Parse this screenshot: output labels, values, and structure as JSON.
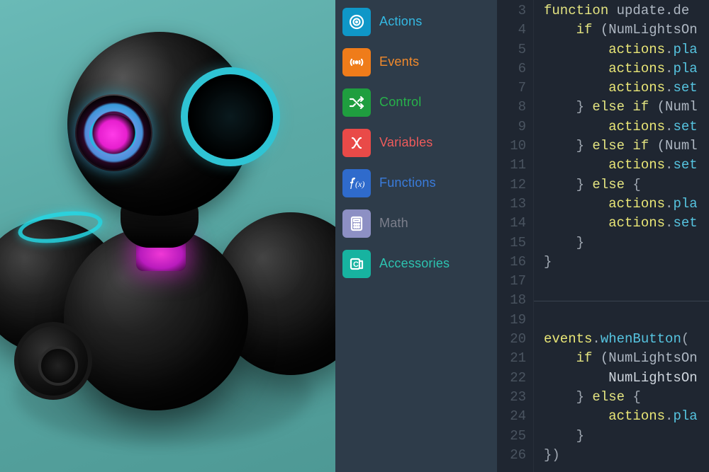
{
  "sidebar": {
    "items": [
      {
        "label": "Actions",
        "labelColor": "#34b9e3",
        "iconBg": "#0f97c8",
        "iconName": "target-icon"
      },
      {
        "label": "Events",
        "labelColor": "#f28a2b",
        "iconBg": "#ef7c1a",
        "iconName": "broadcast-icon"
      },
      {
        "label": "Control",
        "labelColor": "#27b24a",
        "iconBg": "#1f9e3f",
        "iconName": "shuffle-icon"
      },
      {
        "label": "Variables",
        "labelColor": "#ef5b5b",
        "iconBg": "#e94a48",
        "iconName": "x-variable-icon"
      },
      {
        "label": "Functions",
        "labelColor": "#3a7cdc",
        "iconBg": "#2f6bcc",
        "iconName": "fx-icon"
      },
      {
        "label": "Math",
        "labelColor": "#7c7f8c",
        "iconBg": "#8d90c4",
        "iconName": "calculator-icon"
      },
      {
        "label": "Accessories",
        "labelColor": "#2dc3b0",
        "iconBg": "#17b3a0",
        "iconName": "accessories-icon"
      }
    ]
  },
  "editor": {
    "lineStart": 3,
    "lines": [
      {
        "indent": 0,
        "tokens": [
          [
            "kw",
            "function"
          ],
          [
            "pl",
            " update.de"
          ]
        ]
      },
      {
        "indent": 1,
        "tokens": [
          [
            "kw",
            "if"
          ],
          [
            "pl",
            " (NumLightsOn"
          ]
        ]
      },
      {
        "indent": 2,
        "tokens": [
          [
            "obj",
            "actions"
          ],
          [
            "punc",
            "."
          ],
          [
            "fn",
            "pla"
          ]
        ]
      },
      {
        "indent": 2,
        "tokens": [
          [
            "obj",
            "actions"
          ],
          [
            "punc",
            "."
          ],
          [
            "fn",
            "pla"
          ]
        ]
      },
      {
        "indent": 2,
        "tokens": [
          [
            "obj",
            "actions"
          ],
          [
            "punc",
            "."
          ],
          [
            "fn",
            "set"
          ]
        ]
      },
      {
        "indent": 1,
        "tokens": [
          [
            "punc",
            "} "
          ],
          [
            "kw",
            "else if"
          ],
          [
            "pl",
            " (Numl"
          ]
        ]
      },
      {
        "indent": 2,
        "tokens": [
          [
            "obj",
            "actions"
          ],
          [
            "punc",
            "."
          ],
          [
            "fn",
            "set"
          ]
        ]
      },
      {
        "indent": 1,
        "tokens": [
          [
            "punc",
            "} "
          ],
          [
            "kw",
            "else if"
          ],
          [
            "pl",
            " (Numl"
          ]
        ]
      },
      {
        "indent": 2,
        "tokens": [
          [
            "obj",
            "actions"
          ],
          [
            "punc",
            "."
          ],
          [
            "fn",
            "set"
          ]
        ]
      },
      {
        "indent": 1,
        "tokens": [
          [
            "punc",
            "} "
          ],
          [
            "kw",
            "else"
          ],
          [
            "punc",
            " {"
          ]
        ]
      },
      {
        "indent": 2,
        "tokens": [
          [
            "obj",
            "actions"
          ],
          [
            "punc",
            "."
          ],
          [
            "fn",
            "pla"
          ]
        ]
      },
      {
        "indent": 2,
        "tokens": [
          [
            "obj",
            "actions"
          ],
          [
            "punc",
            "."
          ],
          [
            "fn",
            "set"
          ]
        ]
      },
      {
        "indent": 1,
        "tokens": [
          [
            "punc",
            "}"
          ]
        ]
      },
      {
        "indent": 0,
        "tokens": [
          [
            "punc",
            "}"
          ]
        ]
      },
      {
        "indent": 0,
        "tokens": []
      },
      {
        "indent": 0,
        "tokens": []
      },
      {
        "indent": 0,
        "tokens": []
      },
      {
        "indent": 0,
        "tokens": [
          [
            "obj",
            "events"
          ],
          [
            "punc",
            "."
          ],
          [
            "fn",
            "whenButton"
          ],
          [
            "punc",
            "("
          ]
        ]
      },
      {
        "indent": 1,
        "tokens": [
          [
            "kw",
            "if"
          ],
          [
            "pl",
            " (NumLightsOn"
          ]
        ]
      },
      {
        "indent": 2,
        "tokens": [
          [
            "id",
            "NumLightsOn"
          ]
        ]
      },
      {
        "indent": 1,
        "tokens": [
          [
            "punc",
            "} "
          ],
          [
            "kw",
            "else"
          ],
          [
            "punc",
            " {"
          ]
        ]
      },
      {
        "indent": 2,
        "tokens": [
          [
            "obj",
            "actions"
          ],
          [
            "punc",
            "."
          ],
          [
            "fn",
            "pla"
          ]
        ]
      },
      {
        "indent": 1,
        "tokens": [
          [
            "punc",
            "}"
          ]
        ]
      },
      {
        "indent": 0,
        "tokens": [
          [
            "punc",
            "})"
          ]
        ]
      }
    ]
  }
}
